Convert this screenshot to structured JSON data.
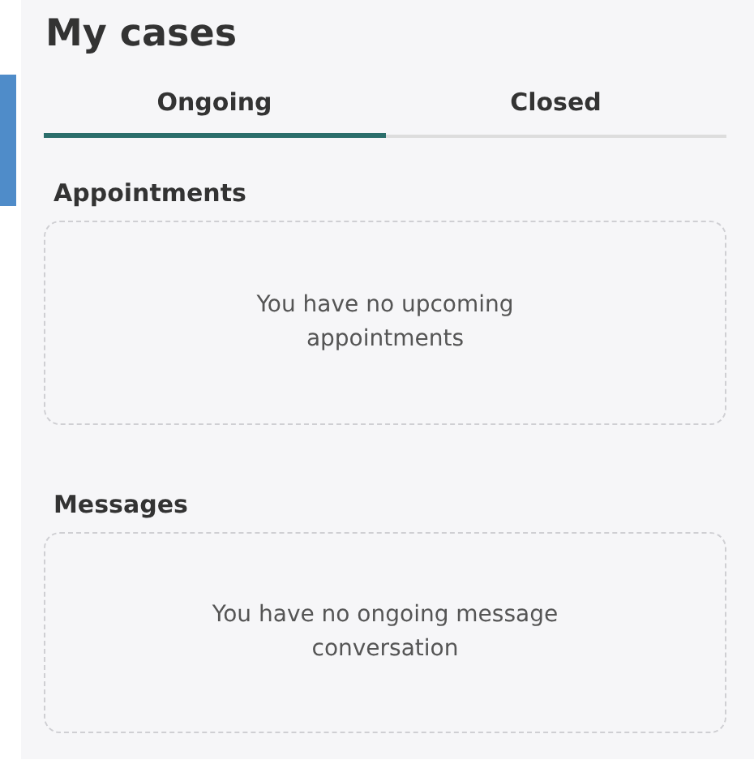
{
  "title": "My cases",
  "tabs": [
    {
      "label": "Ongoing",
      "selected": true
    },
    {
      "label": "Closed",
      "selected": false
    }
  ],
  "sections": [
    {
      "heading": "Appointments",
      "empty_text": "You have no upcoming appointments"
    },
    {
      "heading": "Messages",
      "empty_text": "You have no ongoing message conversation"
    }
  ]
}
